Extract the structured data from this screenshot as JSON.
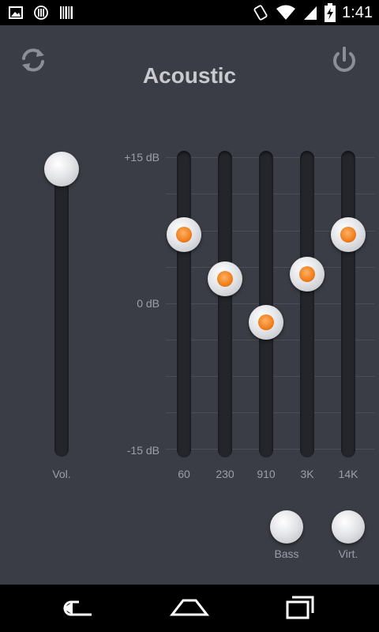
{
  "status_bar": {
    "time": "1:41",
    "left_icons": [
      "image-icon",
      "equalizer-app-icon",
      "barcode-icon"
    ],
    "right_icons": [
      "screen-rotate-icon",
      "wifi-icon",
      "signal-icon",
      "battery-charging-icon"
    ]
  },
  "header": {
    "title": "Acoustic",
    "left_icon": "refresh-icon",
    "right_icon": "power-icon"
  },
  "scale": {
    "top_label": "+15 dB",
    "mid_label": "0 dB",
    "bottom_label": "-15 dB",
    "min_db": -15,
    "max_db": 15
  },
  "volume": {
    "label": "Vol.",
    "level_fraction": 1.0
  },
  "bands": [
    {
      "label": "60",
      "db": 7
    },
    {
      "label": "230",
      "db": 2.5
    },
    {
      "label": "910",
      "db": -2
    },
    {
      "label": "3K",
      "db": 3
    },
    {
      "label": "14K",
      "db": 7
    }
  ],
  "effects": [
    {
      "label": "Bass"
    },
    {
      "label": "Virt."
    }
  ],
  "colors": {
    "panel_bg": "#3b3d46",
    "track": "#23252b",
    "accent": "#f07f1a",
    "text": "#9c9fa8"
  },
  "nav": {
    "icons": [
      "back-icon",
      "home-icon",
      "recent-apps-icon"
    ]
  }
}
